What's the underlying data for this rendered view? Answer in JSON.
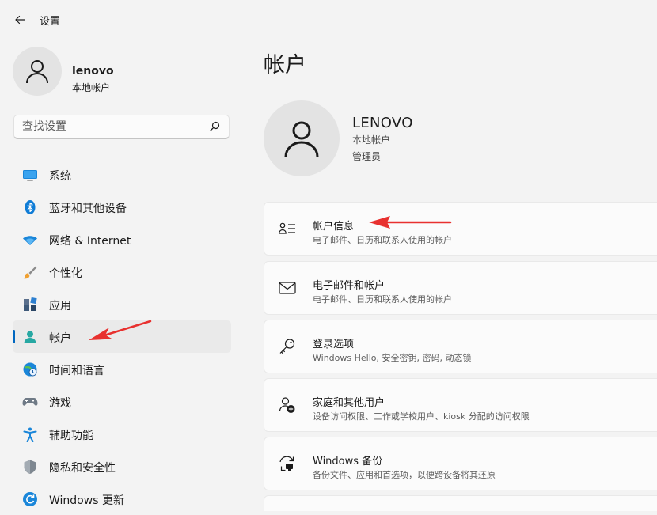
{
  "window": {
    "title": "设置"
  },
  "profile": {
    "name": "lenovo",
    "account_type": "本地帐户"
  },
  "search": {
    "placeholder": "查找设置"
  },
  "sidebar": {
    "items": [
      {
        "label": "系统",
        "icon": "monitor-icon"
      },
      {
        "label": "蓝牙和其他设备",
        "icon": "bluetooth-icon"
      },
      {
        "label": "网络 & Internet",
        "icon": "wifi-icon"
      },
      {
        "label": "个性化",
        "icon": "brush-icon"
      },
      {
        "label": "应用",
        "icon": "apps-icon"
      },
      {
        "label": "帐户",
        "icon": "person-icon",
        "active": true
      },
      {
        "label": "时间和语言",
        "icon": "globe-clock-icon"
      },
      {
        "label": "游戏",
        "icon": "gamepad-icon"
      },
      {
        "label": "辅助功能",
        "icon": "accessibility-icon"
      },
      {
        "label": "隐私和安全性",
        "icon": "shield-icon"
      },
      {
        "label": "Windows 更新",
        "icon": "update-icon"
      }
    ]
  },
  "main": {
    "title": "帐户",
    "user": {
      "name": "LENOVO",
      "account_type": "本地帐户",
      "role": "管理员"
    },
    "cards": [
      {
        "title": "帐户信息",
        "subtitle": "电子邮件、日历和联系人使用的帐户",
        "icon": "person-list-icon"
      },
      {
        "title": "电子邮件和帐户",
        "subtitle": "电子邮件、日历和联系人使用的帐户",
        "icon": "mail-icon"
      },
      {
        "title": "登录选项",
        "subtitle": "Windows Hello, 安全密钥, 密码, 动态锁",
        "icon": "key-icon"
      },
      {
        "title": "家庭和其他用户",
        "subtitle": "设备访问权限、工作或学校用户、kiosk 分配的访问权限",
        "icon": "person-add-icon"
      },
      {
        "title": "Windows 备份",
        "subtitle": "备份文件、应用和首选项，以便跨设备将其还原",
        "icon": "backup-icon"
      }
    ]
  },
  "colors": {
    "accent": "#0067c0",
    "annotation_arrow": "#e8312f",
    "background": "#f3f3f3",
    "card": "#fbfbfb"
  }
}
